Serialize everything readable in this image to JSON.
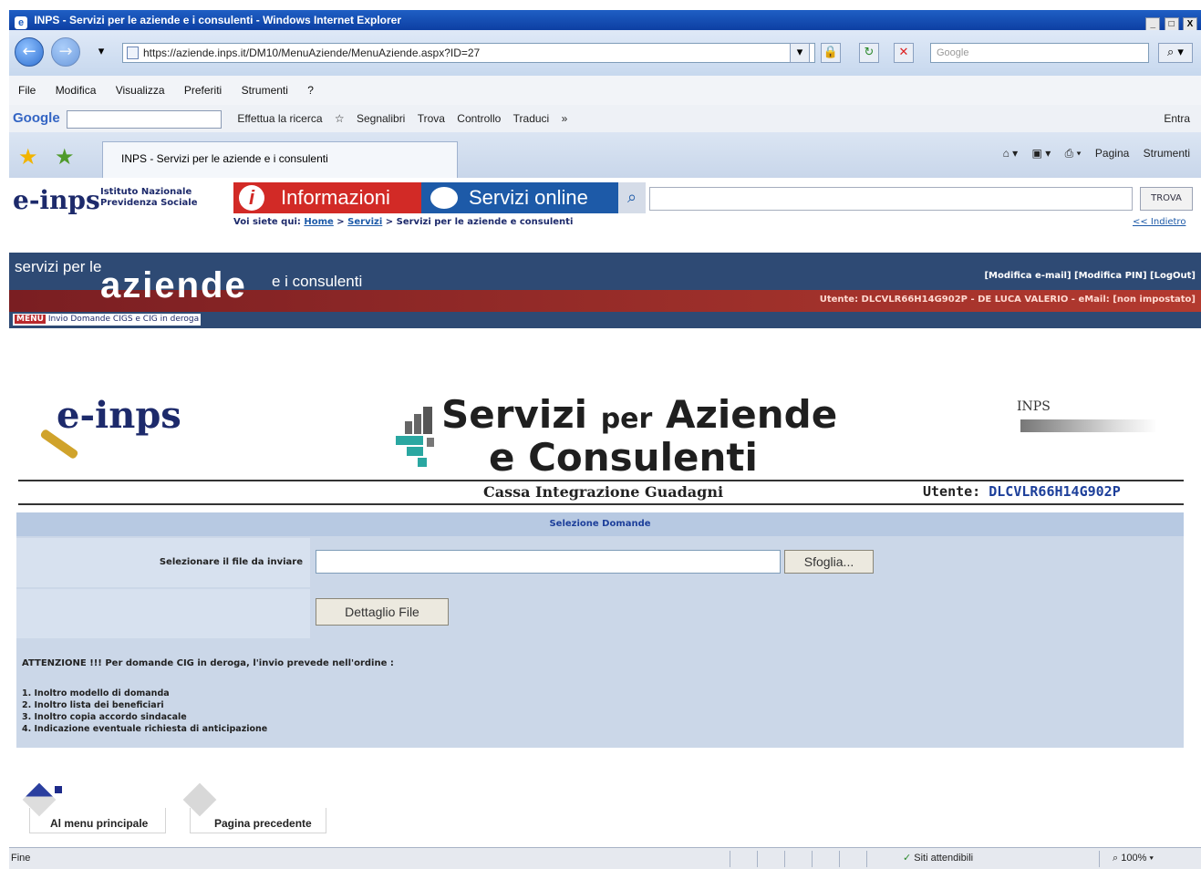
{
  "window": {
    "title": "INPS - Servizi per le aziende e i consulenti - Windows Internet Explorer",
    "controls": [
      "_",
      "□",
      "X"
    ]
  },
  "address_bar": {
    "url": "https://aziende.inps.it/DM10/MenuAziende/MenuAziende.aspx?ID=27",
    "search_placeholder": "Google"
  },
  "menu_bar": {
    "items": [
      "File",
      "Modifica",
      "Visualizza",
      "Preferiti",
      "Strumenti",
      "?"
    ]
  },
  "google_toolbar": {
    "logo": "Google",
    "search_label": "Effettua la ricerca",
    "bookmarks_label": "Segnalibri",
    "find_label": "Trova",
    "check_label": "Controllo",
    "translate_label": "Traduci",
    "more_label": "»",
    "signin_label": "Entra"
  },
  "tab_bar": {
    "tab_title": "INPS - Servizi per le aziende e i consulenti",
    "page_label": "Pagina",
    "tools_label": "Strumenti"
  },
  "inps_header": {
    "logo": "e-inps",
    "institute_line1": "Istituto Nazionale",
    "institute_line2": "Previdenza Sociale",
    "info_tab": "Informazioni",
    "services_tab": "Servizi online",
    "find_button": "TROVA",
    "breadcrumb_prefix": "Voi siete qui:",
    "breadcrumb_home": "Home",
    "breadcrumb_servizi": "Servizi",
    "breadcrumb_current": "Servizi per le aziende e consulenti",
    "back_link": "<< Indietro"
  },
  "banner": {
    "servizi_per_le": "servizi per le",
    "aziende": "aziende",
    "consulenti": "e i consulenti",
    "account_links": "[Modifica e-mail]  [Modifica PIN]  [LogOut]",
    "user_line": "Utente: DLCVLR66H14G902P - DE LUCA VALERIO - eMail: [non impostato]",
    "menu_label": "MENU",
    "menu_path": "Invio Domande CIGS e CIG in deroga"
  },
  "logos": {
    "einps": "e-inps",
    "title_servizi": "Servizi",
    "title_per": "per",
    "title_aziende": "Aziende",
    "title_line2": "e Consulenti",
    "right_logo": "INPS"
  },
  "subheader": {
    "section": "Cassa Integrazione Guadagni",
    "user_label": "Utente:",
    "user_code": "DLCVLR66H14G902P"
  },
  "form": {
    "header": "Selezione Domande",
    "file_label": "Selezionare il file da inviare",
    "browse_button": "Sfoglia...",
    "detail_button": "Dettaglio File",
    "notice": "ATTENZIONE !!! Per domande CIG in deroga, l'invio prevede nell'ordine :",
    "steps": [
      "1. Inoltro modello di domanda",
      "2. Inoltro lista dei beneficiari",
      "3. Inoltro copia accordo sindacale",
      "4. Indicazione eventuale richiesta di anticipazione"
    ]
  },
  "bottom_nav": {
    "main_menu": "Al menu principale",
    "previous_page": "Pagina precedente"
  },
  "status_bar": {
    "status": "Fine",
    "zone": "Siti attendibili",
    "zoom": "100%"
  }
}
